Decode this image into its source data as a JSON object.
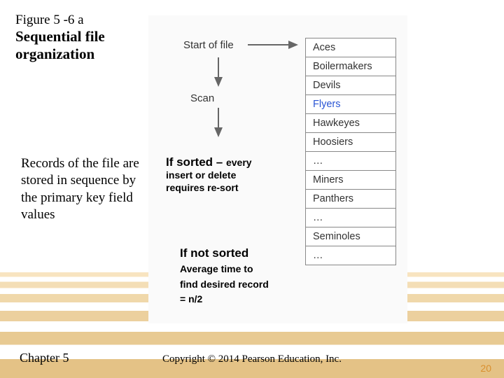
{
  "figure": {
    "label": "Figure 5 -6 a",
    "title_l1": "Sequential file",
    "title_l2": "organization"
  },
  "description": "Records of the file are stored in sequence by the primary key field values",
  "sorted": {
    "heading": "If sorted – ",
    "heading_cont": "every",
    "sub_l1": "insert or delete",
    "sub_l2": "requires re-sort"
  },
  "notsorted": {
    "heading": "If not sorted",
    "sub_l1": "Average time to",
    "sub_l2": "find desired record",
    "sub_l3": "= n/2"
  },
  "diagram": {
    "start_label": "Start of file",
    "scan_label": "Scan",
    "records": [
      {
        "text": "Aces",
        "hl": false
      },
      {
        "text": "Boilermakers",
        "hl": false
      },
      {
        "text": "Devils",
        "hl": false
      },
      {
        "text": "Flyers",
        "hl": true
      },
      {
        "text": "Hawkeyes",
        "hl": false
      },
      {
        "text": "Hoosiers",
        "hl": false
      },
      {
        "text": "…",
        "hl": false,
        "dots": true
      },
      {
        "text": "Miners",
        "hl": false
      },
      {
        "text": "Panthers",
        "hl": false
      },
      {
        "text": "…",
        "hl": false,
        "dots": true
      },
      {
        "text": "Seminoles",
        "hl": false
      },
      {
        "text": "…",
        "hl": false,
        "dots": true
      }
    ]
  },
  "footer": {
    "chapter": "Chapter 5",
    "copyright": "Copyright © 2014 Pearson Education, Inc.",
    "page": "20"
  },
  "colors": {
    "highlight": "#2a55d4",
    "arrow": "#666"
  }
}
